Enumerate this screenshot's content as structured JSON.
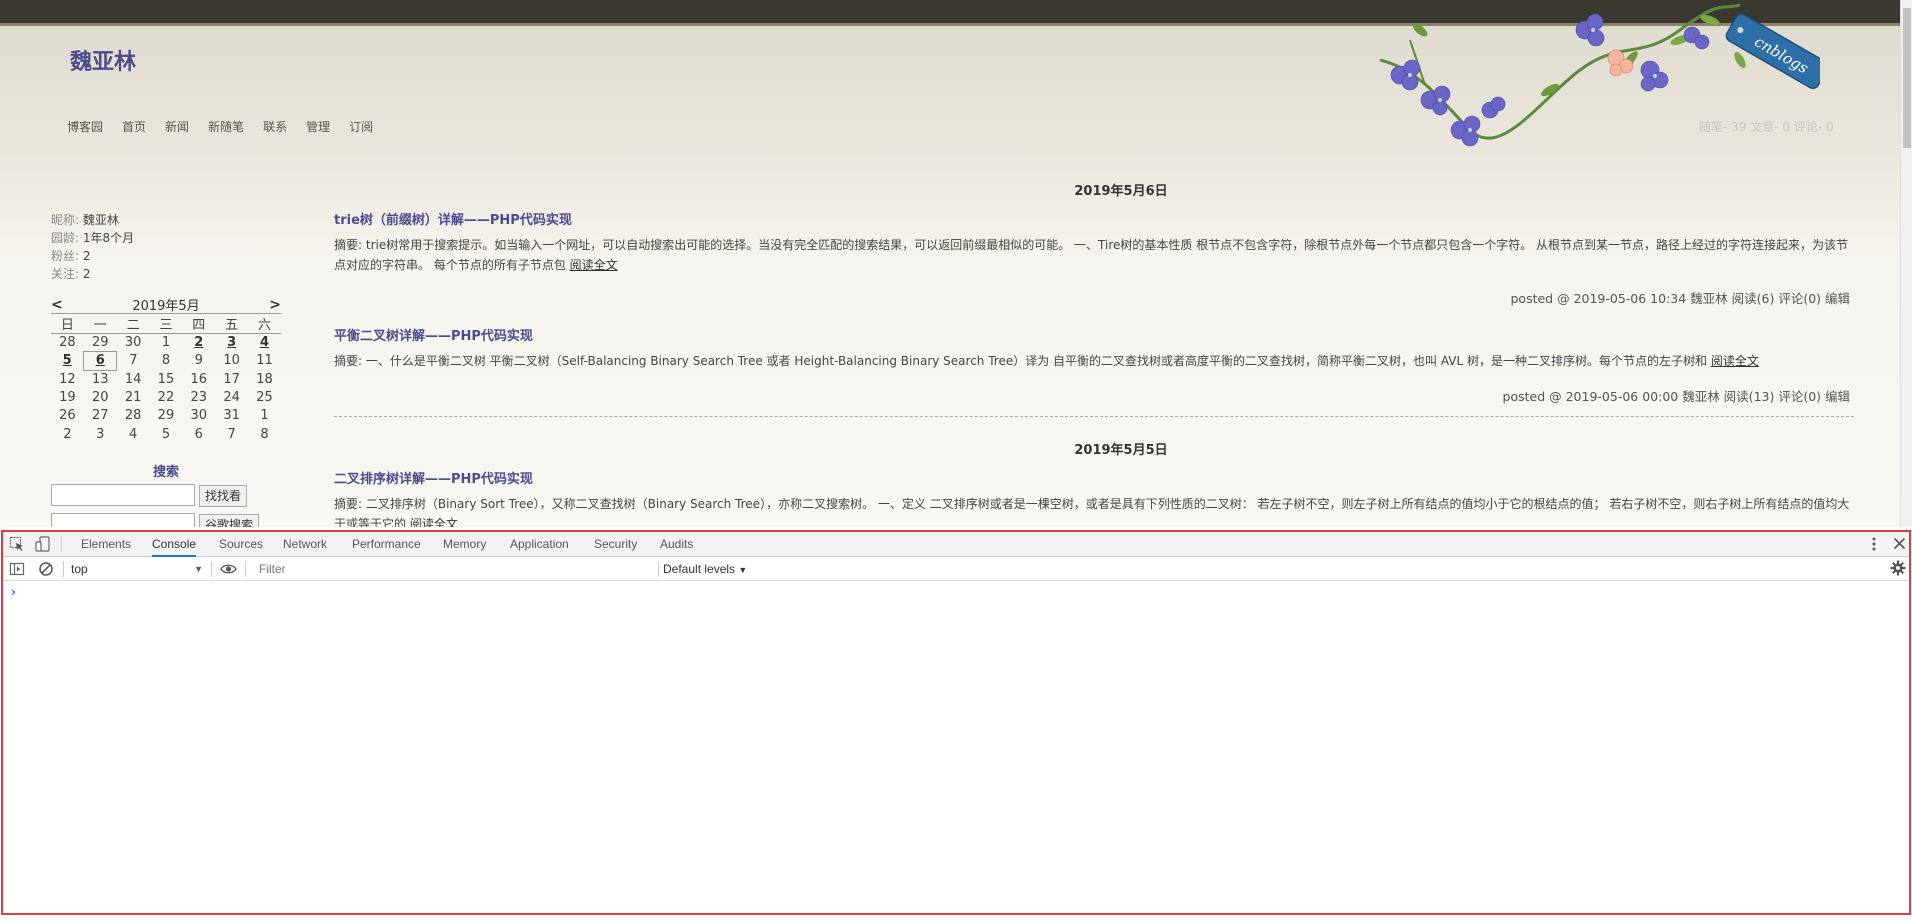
{
  "blog": {
    "title": "魏亚林",
    "nav": [
      "博客园",
      "首页",
      "新闻",
      "新随笔",
      "联系",
      "管理",
      "订阅"
    ],
    "stats": "随笔- 39  文章- 0  评论- 0",
    "badge": "cnblogs",
    "profile": [
      {
        "label": "昵称:",
        "value": "魏亚林"
      },
      {
        "label": "园龄:",
        "value": "1年8个月"
      },
      {
        "label": "粉丝:",
        "value": "2"
      },
      {
        "label": "关注:",
        "value": "2"
      }
    ],
    "calendar": {
      "prev": "<",
      "next": ">",
      "month": "2019年5月",
      "weekdays": [
        "日",
        "一",
        "二",
        "三",
        "四",
        "五",
        "六"
      ],
      "weeks": [
        [
          "28",
          "29",
          "30",
          "1",
          "2",
          "3",
          "4"
        ],
        [
          "5",
          "6",
          "7",
          "8",
          "9",
          "10",
          "11"
        ],
        [
          "12",
          "13",
          "14",
          "15",
          "16",
          "17",
          "18"
        ],
        [
          "19",
          "20",
          "21",
          "22",
          "23",
          "24",
          "25"
        ],
        [
          "26",
          "27",
          "28",
          "29",
          "30",
          "31",
          "1"
        ],
        [
          "2",
          "3",
          "4",
          "5",
          "6",
          "7",
          "8"
        ]
      ]
    },
    "search": {
      "title": "搜索",
      "btn1": "找找看",
      "btn2": "谷歌搜索"
    },
    "days": [
      {
        "date": "2019年5月6日",
        "posts": [
          {
            "title": "trie树（前缀树）详解——PHP代码实现",
            "summary": "摘要: trie树常用于搜索提示。如当输入一个网址，可以自动搜索出可能的选择。当没有完全匹配的搜索结果，可以返回前缀最相似的可能。 一、Tire树的基本性质 根节点不包含字符，除根节点外每一个节点都只包含一个字符。 从根节点到某一节点，路径上经过的字符连接起来，为该节点对应的字符串。 每个节点的所有子节点包",
            "more": "阅读全文",
            "footer": "posted @ 2019-05-06 10:34 魏亚林 阅读(6) 评论(0) 编辑"
          },
          {
            "title": "平衡二叉树详解——PHP代码实现",
            "summary": "摘要: 一、什么是平衡二叉树 平衡二叉树（Self-Balancing Binary Search Tree 或者 Height-Balancing Binary Search Tree）译为 自平衡的二叉查找树或者高度平衡的二叉查找树，简称平衡二叉树，也叫 AVL 树，是一种二叉排序树。每个节点的左子树和",
            "more": "阅读全文",
            "footer": "posted @ 2019-05-06 00:00 魏亚林 阅读(13) 评论(0) 编辑"
          }
        ]
      },
      {
        "date": "2019年5月5日",
        "posts": [
          {
            "title": "二叉排序树详解——PHP代码实现",
            "summary": "摘要: 二叉排序树（Binary Sort Tree），又称二叉查找树（Binary Search Tree），亦称二叉搜索树。 一、定义 二叉排序树或者是一棵空树，或者是具有下列性质的二叉树： 若左子树不空，则左子树上所有结点的值均小于它的根结点的值； 若右子树不空，则右子树上所有结点的值均大于或等于它的",
            "more": "阅读全文"
          }
        ]
      }
    ]
  },
  "devtools": {
    "tabs": [
      "Elements",
      "Console",
      "Sources",
      "Network",
      "Performance",
      "Memory",
      "Application",
      "Security",
      "Audits"
    ],
    "active_tab": "Console",
    "context": "top",
    "filter_placeholder": "Filter",
    "levels": "Default levels",
    "prompt": "›",
    "accent": "#1a73e8",
    "border": "#e03a44"
  }
}
